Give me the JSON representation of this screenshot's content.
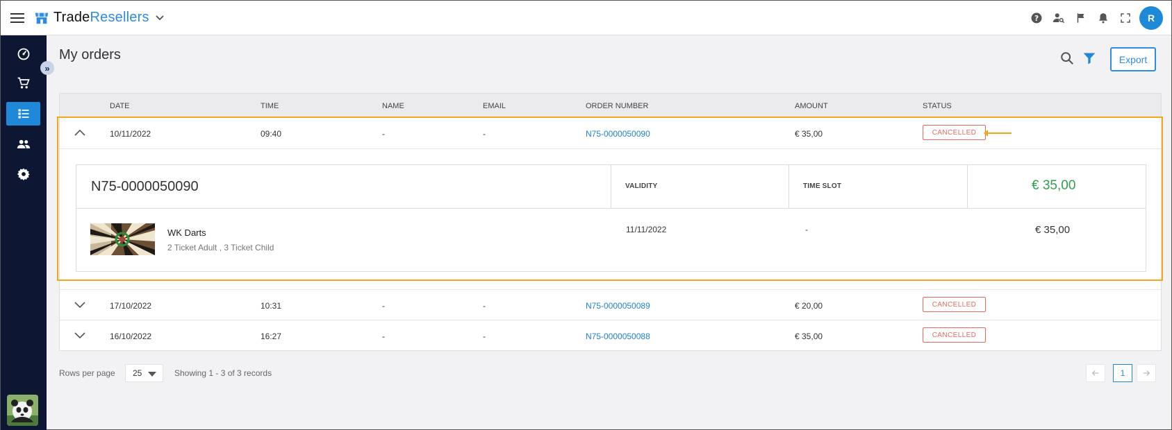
{
  "app": {
    "brand_primary": "Trade",
    "brand_secondary": "Resellers",
    "avatar_initial": "R",
    "accent_color": "#1e88d9",
    "cancelled_color": "#e46a5d",
    "highlight_color": "#f5a61a"
  },
  "topbar": {
    "icons": [
      "help-icon",
      "user-search-icon",
      "flag-icon",
      "bell-icon",
      "fullscreen-icon"
    ]
  },
  "sidebar": {
    "items": [
      "dashboard-icon",
      "cart-icon",
      "orders-list-icon",
      "users-icon",
      "settings-icon"
    ],
    "active_item": "orders-list-icon"
  },
  "page": {
    "title": "My orders",
    "export_label": "Export"
  },
  "table": {
    "headers": {
      "date": "DATE",
      "time": "TIME",
      "name": "NAME",
      "email": "EMAIL",
      "order_number": "ORDER NUMBER",
      "amount": "AMOUNT",
      "status": "STATUS"
    },
    "rows": [
      {
        "date": "10/11/2022",
        "time": "09:40",
        "name": "-",
        "email": "-",
        "order_number": "N75-0000050090",
        "amount": "€ 35,00",
        "status": "CANCELLED",
        "expanded": true
      },
      {
        "date": "17/10/2022",
        "time": "10:31",
        "name": "-",
        "email": "-",
        "order_number": "N75-0000050089",
        "amount": "€ 20,00",
        "status": "CANCELLED",
        "expanded": false
      },
      {
        "date": "16/10/2022",
        "time": "16:27",
        "name": "-",
        "email": "-",
        "order_number": "N75-0000050088",
        "amount": "€ 35,00",
        "status": "CANCELLED",
        "expanded": false
      }
    ]
  },
  "detail": {
    "order_number": "N75-0000050090",
    "validity_label": "VALIDITY",
    "timeslot_label": "TIME SLOT",
    "total": "€ 35,00",
    "product_name": "WK Darts",
    "product_tickets": "2 Ticket Adult , 3 Ticket Child",
    "validity": "11/11/2022",
    "timeslot": "-",
    "product_amount": "€ 35,00"
  },
  "footer": {
    "rows_per_page_label": "Rows per page",
    "rows_per_page_value": "25",
    "showing": "Showing 1 - 3 of 3 records",
    "current_page": "1"
  }
}
